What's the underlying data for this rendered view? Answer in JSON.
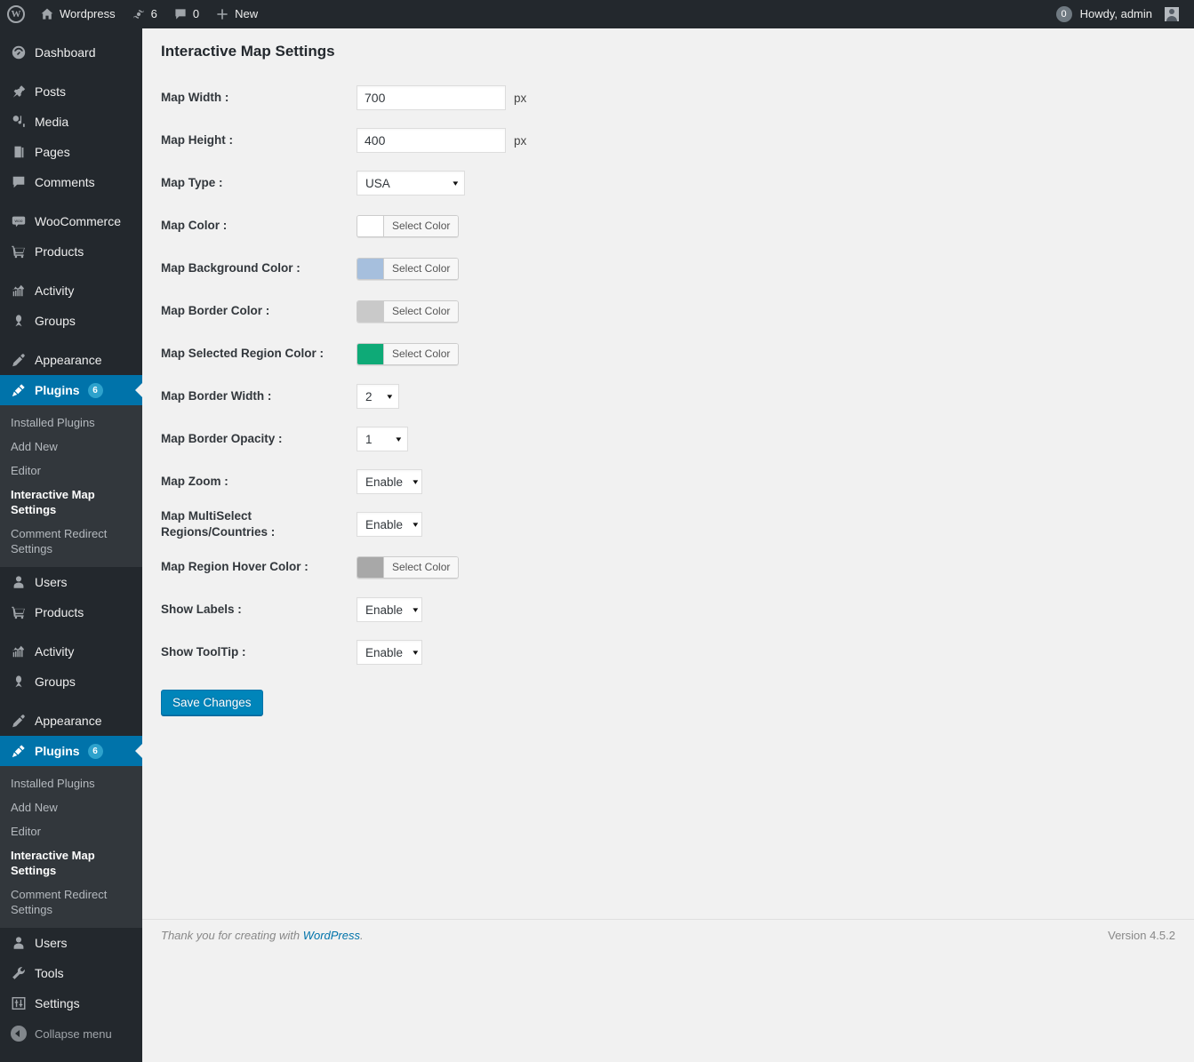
{
  "adminbar": {
    "wp_logo_icon": "wordpress-logo-icon",
    "site_icon": "home-icon",
    "site_name": "Wordpress",
    "updates_icon": "updates-icon",
    "updates_count": "6",
    "comments_icon": "comment-bubble-icon",
    "comments_count": "0",
    "new_icon": "plus-icon",
    "new_label": "New",
    "notifications_count": "0",
    "howdy": "Howdy, admin",
    "avatar_icon": "avatar-icon"
  },
  "sidebar": {
    "groups": [
      {
        "items": [
          {
            "label": "Dashboard",
            "icon": "dashboard-icon"
          }
        ]
      },
      {
        "items": [
          {
            "label": "Posts",
            "icon": "pin-icon"
          },
          {
            "label": "Media",
            "icon": "media-icon"
          },
          {
            "label": "Pages",
            "icon": "pages-icon"
          },
          {
            "label": "Comments",
            "icon": "comment-bubble-icon"
          }
        ]
      },
      {
        "items": [
          {
            "label": "WooCommerce",
            "icon": "woocommerce-icon"
          },
          {
            "label": "Products",
            "icon": "cart-icon"
          }
        ]
      },
      {
        "items": [
          {
            "label": "Activity",
            "icon": "activity-icon"
          },
          {
            "label": "Groups",
            "icon": "groups-icon"
          }
        ]
      },
      {
        "items": [
          {
            "label": "Appearance",
            "icon": "brush-icon"
          }
        ]
      }
    ],
    "plugins": {
      "label": "Plugins",
      "icon": "plug-icon",
      "badge": "6",
      "submenu": [
        {
          "label": "Installed Plugins",
          "current": false
        },
        {
          "label": "Add New",
          "current": false
        },
        {
          "label": "Editor",
          "current": false
        },
        {
          "label": "Interactive Map Settings",
          "current": true
        },
        {
          "label": "Comment Redirect Settings",
          "current": false
        }
      ]
    },
    "after_plugins_1": {
      "items": [
        {
          "label": "Users",
          "icon": "user-icon"
        },
        {
          "label": "Products",
          "icon": "cart-icon"
        }
      ]
    },
    "after_plugins_2": {
      "items": [
        {
          "label": "Activity",
          "icon": "activity-icon"
        },
        {
          "label": "Groups",
          "icon": "groups-icon"
        }
      ]
    },
    "after_plugins_3": {
      "items": [
        {
          "label": "Appearance",
          "icon": "brush-icon"
        }
      ]
    },
    "tail": {
      "items": [
        {
          "label": "Users",
          "icon": "user-icon"
        },
        {
          "label": "Tools",
          "icon": "wrench-icon"
        },
        {
          "label": "Settings",
          "icon": "settings-sliders-icon"
        }
      ]
    },
    "collapse": {
      "label": "Collapse menu",
      "icon": "collapse-arrow-icon"
    }
  },
  "page": {
    "title": "Interactive Map Settings"
  },
  "form": {
    "select_color_label": "Select Color",
    "unit_px": "px",
    "caret": "▾",
    "rows": [
      {
        "id": "map-width",
        "label": "Map Width :",
        "type": "text",
        "value": "700",
        "unit": "px"
      },
      {
        "id": "map-height",
        "label": "Map Height :",
        "type": "text",
        "value": "400",
        "unit": "px"
      },
      {
        "id": "map-type",
        "label": "Map Type :",
        "type": "select",
        "value": "USA"
      },
      {
        "id": "map-color",
        "label": "Map Color :",
        "type": "color",
        "value": "#ffffff"
      },
      {
        "id": "map-background-color",
        "label": "Map Background Color :",
        "type": "color",
        "value": "#a6bfdd"
      },
      {
        "id": "map-border-color",
        "label": "Map Border Color :",
        "type": "color",
        "value": "#c9c9c9"
      },
      {
        "id": "map-selected-region-color",
        "label": "Map Selected Region Color :",
        "type": "color",
        "value": "#0eaa77"
      },
      {
        "id": "map-border-width",
        "label": "Map Border Width :",
        "type": "select",
        "value": "2"
      },
      {
        "id": "map-border-opacity",
        "label": "Map Border Opacity :",
        "type": "select",
        "value": "1"
      },
      {
        "id": "map-zoom",
        "label": "Map Zoom :",
        "type": "select",
        "value": "Enable"
      },
      {
        "id": "map-multiselect",
        "label": "Map MultiSelect Regions/Countries :",
        "type": "select",
        "value": "Enable"
      },
      {
        "id": "map-region-hover-color",
        "label": "Map Region Hover Color :",
        "type": "color",
        "value": "#a8a8a8"
      },
      {
        "id": "show-labels",
        "label": "Show Labels :",
        "type": "select",
        "value": "Enable"
      },
      {
        "id": "show-tooltip",
        "label": "Show ToolTip :",
        "type": "select",
        "value": "Enable"
      }
    ],
    "save_label": "Save Changes"
  },
  "footer": {
    "thankyou_prefix": "Thank you for creating with ",
    "thankyou_link": "WordPress",
    "thankyou_suffix": ".",
    "version": "Version 4.5.2"
  },
  "colors": {
    "admin_bar_bg": "#23282d",
    "menu_bg": "#23282d",
    "submenu_bg": "#32373c",
    "accent": "#0073aa",
    "badge": "#0099cc",
    "button": "#0085ba",
    "content_bg": "#f1f1f1"
  }
}
